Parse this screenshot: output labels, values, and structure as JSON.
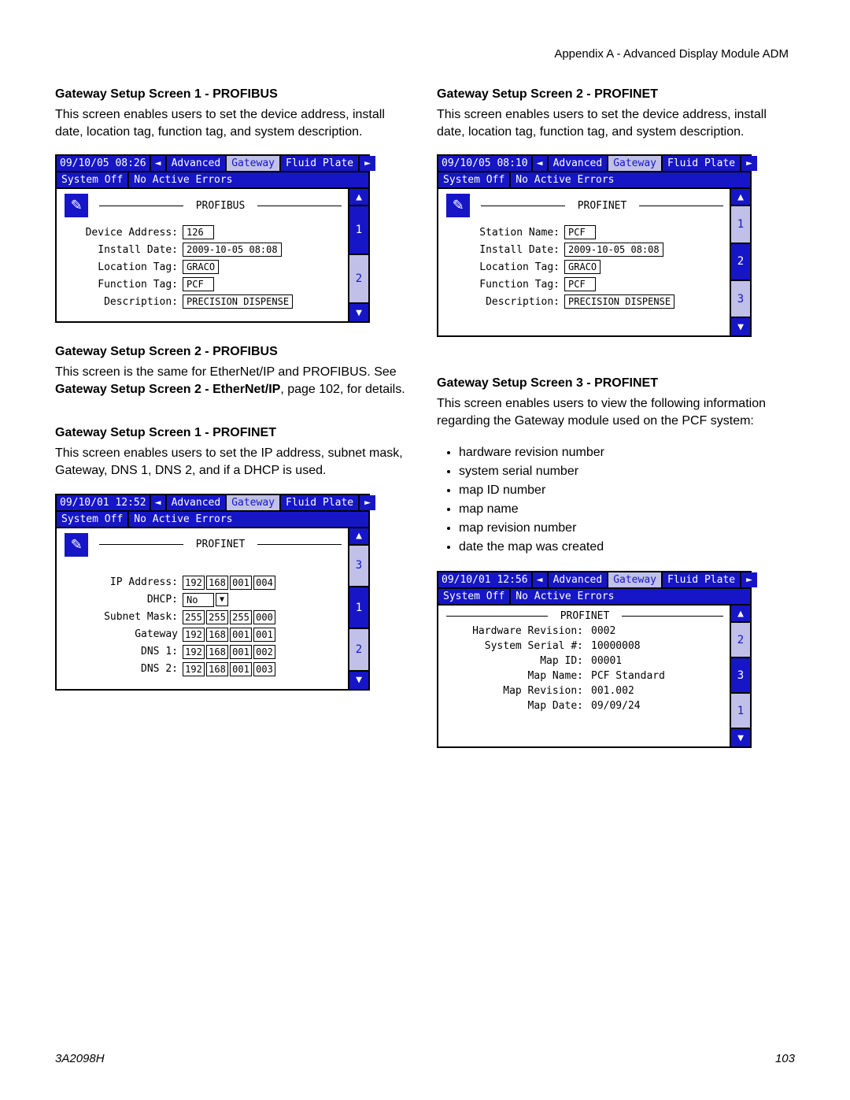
{
  "header_right": "Appendix A - Advanced Display Module ADM",
  "footer_left": "3A2098H",
  "footer_right": "103",
  "left": {
    "s1": {
      "title": "Gateway Setup Screen 1 - PROFIBUS",
      "body": "This screen enables users to set the device address, install date, location tag, function tag, and system description."
    },
    "s2": {
      "title": "Gateway Setup Screen 2 - PROFIBUS",
      "body_pre": "This screen is the same for EtherNet/IP and PROFIBUS. See ",
      "body_bold": "Gateway Setup Screen 2 - EtherNet/IP",
      "body_post": ", page 102, for details."
    },
    "s3": {
      "title": "Gateway Setup Screen 1 - PROFINET",
      "body": "This screen enables users to set the IP address, subnet mask, Gateway, DNS 1, DNS 2, and if a DHCP is used."
    }
  },
  "right": {
    "s1": {
      "title": "Gateway Setup Screen 2 - PROFINET",
      "body": "This screen enables users to set the device address, install date, location tag, function tag, and system description."
    },
    "s2": {
      "title": "Gateway Setup Screen 3 - PROFINET",
      "body": "This screen enables users to view the following information regarding the Gateway module used on the PCF system:",
      "bullets": [
        "hardware revision number",
        "system serial number",
        "map ID number",
        "map name",
        "map revision number",
        "date the map was created"
      ]
    }
  },
  "adm_common": {
    "tabs": {
      "t1": "Advanced",
      "t2": "Gateway",
      "t3": "Fluid Plate"
    },
    "sys": "System Off",
    "err": "No Active Errors",
    "arrow_left": "◄",
    "arrow_right": "►",
    "arrow_up": "▲",
    "arrow_down": "▼"
  },
  "adm1": {
    "ts": "09/10/05 08:26",
    "title": "PROFIBUS",
    "fields": {
      "device_address": {
        "lbl": "Device Address:",
        "val": "126"
      },
      "install_date": {
        "lbl": "Install Date:",
        "val": "2009-10-05 08:08"
      },
      "location_tag": {
        "lbl": "Location Tag:",
        "val": "GRACO"
      },
      "function_tag": {
        "lbl": "Function Tag:",
        "val": "PCF"
      },
      "description": {
        "lbl": "Description:",
        "val": "PRECISION DISPENSE"
      }
    },
    "side": [
      "1",
      "2"
    ]
  },
  "adm2": {
    "ts": "09/10/01 12:52",
    "title": "PROFINET",
    "fields": {
      "ip": {
        "lbl": "IP Address:",
        "seg": [
          "192",
          "168",
          "001",
          "004"
        ]
      },
      "dhcp": {
        "lbl": "DHCP:",
        "val": "No"
      },
      "subnet": {
        "lbl": "Subnet Mask:",
        "seg": [
          "255",
          "255",
          "255",
          "000"
        ]
      },
      "gateway": {
        "lbl": "Gateway",
        "seg": [
          "192",
          "168",
          "001",
          "001"
        ]
      },
      "dns1": {
        "lbl": "DNS 1:",
        "seg": [
          "192",
          "168",
          "001",
          "002"
        ]
      },
      "dns2": {
        "lbl": "DNS 2:",
        "seg": [
          "192",
          "168",
          "001",
          "003"
        ]
      }
    },
    "side": [
      "3",
      "1",
      "2"
    ]
  },
  "adm3": {
    "ts": "09/10/05 08:10",
    "title": "PROFINET",
    "fields": {
      "station_name": {
        "lbl": "Station Name:",
        "val": "PCF"
      },
      "install_date": {
        "lbl": "Install Date:",
        "val": "2009-10-05 08:08"
      },
      "location_tag": {
        "lbl": "Location Tag:",
        "val": "GRACO"
      },
      "function_tag": {
        "lbl": "Function Tag:",
        "val": "PCF"
      },
      "description": {
        "lbl": "Description:",
        "val": "PRECISION DISPENSE"
      }
    },
    "side": [
      "1",
      "2",
      "3"
    ]
  },
  "adm4": {
    "ts": "09/10/01 12:56",
    "title": "PROFINET",
    "fields": {
      "hw": {
        "lbl": "Hardware Revision:",
        "val": "0002"
      },
      "serial": {
        "lbl": "System Serial #:",
        "val": "10000008"
      },
      "mapid": {
        "lbl": "Map ID:",
        "val": "00001"
      },
      "mapname": {
        "lbl": "Map Name:",
        "val": "PCF Standard"
      },
      "maprev": {
        "lbl": "Map  Revision:",
        "val": "001.002"
      },
      "mapdate": {
        "lbl": "Map Date:",
        "val": "09/09/24"
      }
    },
    "side": [
      "2",
      "3",
      "1"
    ]
  }
}
